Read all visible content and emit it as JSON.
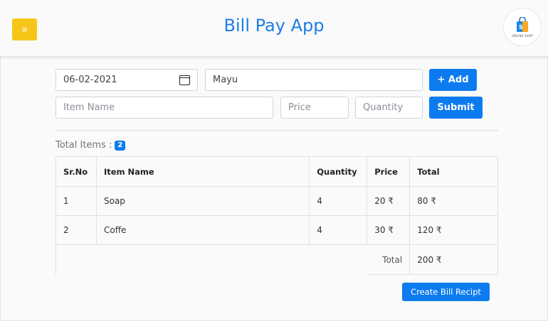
{
  "header": {
    "title": "Bill Pay App",
    "menu_icon": "menu-icon",
    "menu_icon_glyph": "≡",
    "logo_icon": "shopping-bag-icon",
    "logo_text": "ONLINE SHOP",
    "accent_color": "#1d7de8",
    "menu_button_color": "#f5c518"
  },
  "form": {
    "date_value": "06-02-2021",
    "customer_name": "Mayu",
    "item_name_placeholder": "Item Name",
    "price_placeholder": "Price",
    "quantity_placeholder": "Quantity",
    "add_label": "+ Add",
    "submit_label": "Submit"
  },
  "summary": {
    "total_items_label": "Total Items :",
    "total_items_count": "2"
  },
  "table": {
    "headers": [
      "Sr.No",
      "Item Name",
      "Quantity",
      "Price",
      "Total"
    ],
    "rows": [
      {
        "sr": "1",
        "item": "Soap",
        "qty": "4",
        "price": "20 ₹",
        "total": "80 ₹"
      },
      {
        "sr": "2",
        "item": "Coffe",
        "qty": "4",
        "price": "30 ₹",
        "total": "120 ₹"
      }
    ],
    "total_label": "Total",
    "grand_total": "200 ₹"
  },
  "actions": {
    "create_bill_label": "Create Bill Recipt"
  },
  "colors": {
    "primary_button": "#0d7bf0"
  }
}
